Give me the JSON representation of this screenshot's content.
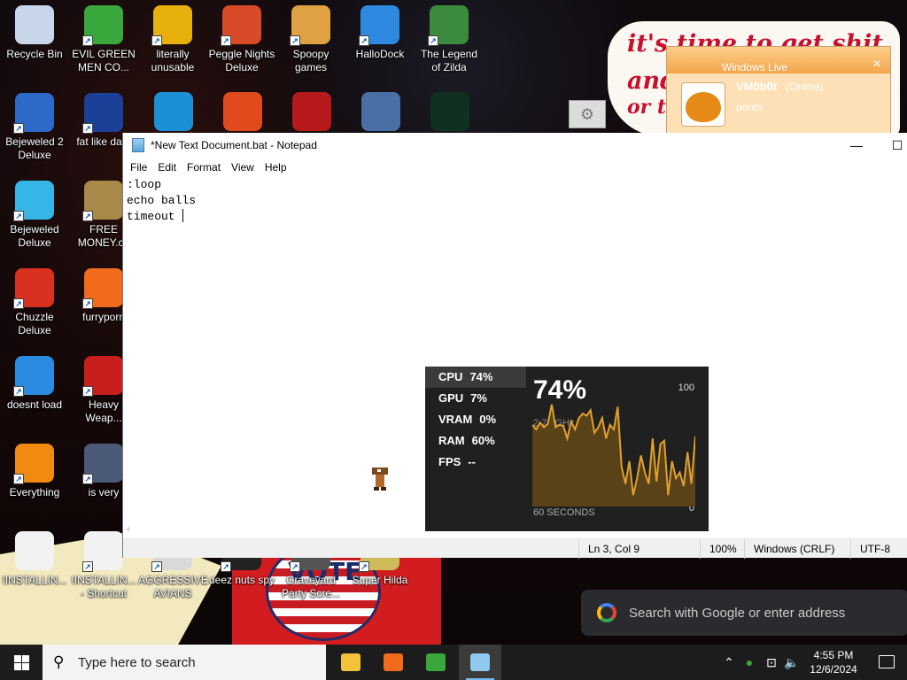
{
  "desktop": {
    "icons": [
      {
        "label": "Recycle Bin",
        "icon": "recycle-bin-icon",
        "color": "#c7d6e8"
      },
      {
        "label": "EVIL GREEN\nMEN CO...",
        "icon": "messenger-users-icon",
        "color": "#3aa73a"
      },
      {
        "label": "literally\nunusable",
        "icon": "chrome-icon",
        "color": "#e8b00c"
      },
      {
        "label": "Peggle Nights\nDeluxe",
        "icon": "peggle-icon",
        "color": "#d94a28"
      },
      {
        "label": "Spoopy\ngames",
        "icon": "folder-games-icon",
        "color": "#e0a143"
      },
      {
        "label": "HalloDock",
        "icon": "windows-shield-icon",
        "color": "#2d8ae0"
      },
      {
        "label": "The Legend\nof Zilda",
        "icon": "zilda-icon",
        "color": "#3c8a3c"
      },
      {
        "label": "Bejeweled 2\nDeluxe",
        "icon": "bejeweled-2-icon",
        "color": "#2c69c9"
      },
      {
        "label": "fat like dark",
        "icon": "mpl-icon",
        "color": "#1c3f98"
      },
      {
        "label": "Bejeweled\nDeluxe",
        "icon": "diamond-icon",
        "color": "#35b6e6"
      },
      {
        "label": "FREE\nMONEY.co",
        "icon": "money-bag-icon",
        "color": "#a88948"
      },
      {
        "label": "Chuzzle\nDeluxe",
        "icon": "chuzzle-icon",
        "color": "#d8311f"
      },
      {
        "label": "furryporn",
        "icon": "firefox-icon",
        "color": "#f26b1d"
      },
      {
        "label": "doesnt load",
        "icon": "thunderbird-icon",
        "color": "#2a8be0"
      },
      {
        "label": "Heavy\nWeap...",
        "icon": "radiation-icon",
        "color": "#c81e1e"
      },
      {
        "label": "Everything",
        "icon": "everything-search-icon",
        "color": "#f08a10"
      },
      {
        "label": "is very",
        "icon": "mp-shield-icon",
        "color": "#4a5a78"
      },
      {
        "label": "!INSTALLIN...",
        "icon": "text-file-icon",
        "color": "#f2f2f2"
      },
      {
        "label": "!INSTALLIN...\n- Shortcut",
        "icon": "text-file-shortcut-icon",
        "color": "#f2f2f2"
      },
      {
        "label": "AGGRESSIVE\nAVIANS",
        "icon": "avians-icon",
        "color": "#d9d9d9"
      },
      {
        "label": "deez nuts spy",
        "icon": "spy-icon",
        "color": "#222222"
      },
      {
        "label": "Graveyard\nParty Scre...",
        "icon": "graveyard-icon",
        "color": "#555555"
      },
      {
        "label": "Super Hilda",
        "icon": "hilda-icon",
        "color": "#cdbb5a"
      }
    ],
    "partial_icons": [
      {
        "icon": "edge-icon",
        "color": "#1d8fd6"
      },
      {
        "icon": "peggle-deluxe-icon",
        "color": "#e04a1c"
      },
      {
        "icon": "flash-icon",
        "color": "#b61a1a"
      },
      {
        "icon": "network-shield-icon",
        "color": "#4a6fa5"
      },
      {
        "icon": "yashma-icon",
        "color": "#103020"
      }
    ],
    "wallpaper": {
      "speech_lines": [
        "it's time to get shit",
        "and",
        "or t"
      ],
      "badge_text": "VOTE"
    }
  },
  "messenger_popup": {
    "title": "Windows Live",
    "display_name": "VM0b0t",
    "status": "(Online)",
    "personal_message": "pents",
    "accent": "#f2a54d"
  },
  "notepad": {
    "title": "*New Text Document.bat - Notepad",
    "menu": [
      "File",
      "Edit",
      "Format",
      "View",
      "Help"
    ],
    "lines": [
      ":loop",
      "echo balls",
      "timeout "
    ],
    "status": {
      "position": "Ln 3, Col 9",
      "zoom": "100%",
      "line_ending": "Windows (CRLF)",
      "encoding": "UTF-8"
    }
  },
  "perf_overlay": {
    "stats": [
      {
        "label": "CPU",
        "value": "74%",
        "active": true
      },
      {
        "label": "GPU",
        "value": "7%"
      },
      {
        "label": "VRAM",
        "value": "0%"
      },
      {
        "label": "RAM",
        "value": "60%"
      },
      {
        "label": "FPS",
        "value": "--"
      }
    ],
    "big_value": "74%",
    "clock": "2.70 GHz",
    "max_label": "100",
    "min_label": "0",
    "window_label": "60 SECONDS",
    "graph_color": "#e0a030",
    "cpu_history": [
      72,
      68,
      74,
      70,
      73,
      90,
      70,
      72,
      71,
      60,
      75,
      68,
      78,
      82,
      80,
      85,
      65,
      70,
      78,
      60,
      72,
      68,
      88,
      35,
      20,
      40,
      10,
      25,
      45,
      30,
      20,
      60,
      22,
      55,
      58,
      10,
      40,
      25,
      30,
      18,
      48,
      20,
      62
    ]
  },
  "google_bar": {
    "placeholder": "Search with Google or enter address"
  },
  "taskbar": {
    "search_placeholder": "Type here to search",
    "apps": [
      {
        "icon": "file-explorer-icon",
        "color": "#f2c33a"
      },
      {
        "icon": "firefox-icon",
        "color": "#f26b1d"
      },
      {
        "icon": "messenger-icon",
        "color": "#3aa73a"
      },
      {
        "icon": "notepad-icon",
        "color": "#8fc9ef",
        "active": true
      }
    ],
    "time": "4:55 PM",
    "date": "12/6/2024"
  }
}
